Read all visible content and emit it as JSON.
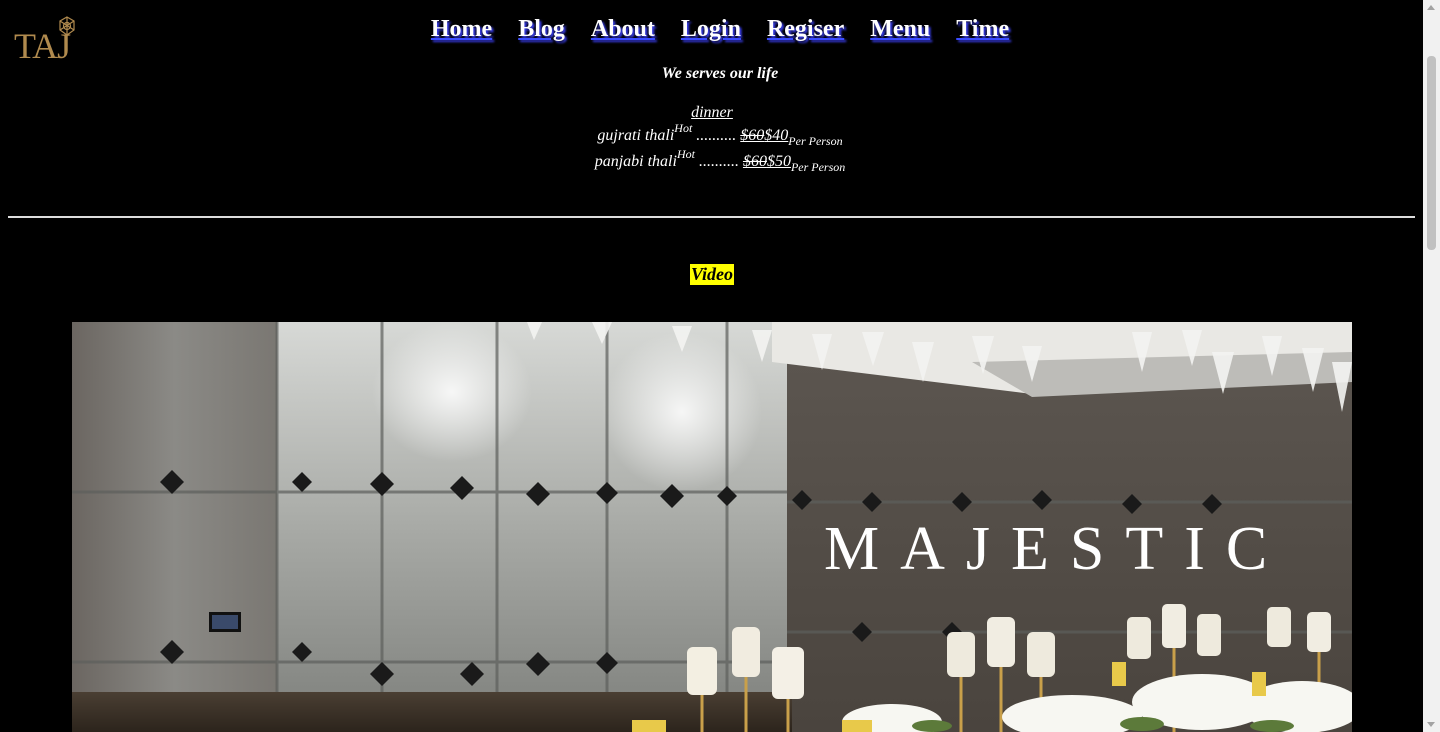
{
  "logo": {
    "text": "TAJ",
    "icon": "taj-emblem-icon",
    "color": "#b08a4e"
  },
  "nav": {
    "items": [
      {
        "label": "Home"
      },
      {
        "label": "Blog"
      },
      {
        "label": "About"
      },
      {
        "label": "Login"
      },
      {
        "label": "Regiser"
      },
      {
        "label": "Menu"
      },
      {
        "label": "Time"
      }
    ]
  },
  "tagline": "We serves our life",
  "menu": {
    "heading": "dinner",
    "items": [
      {
        "name": "gujrati thali",
        "badge": "Hot",
        "dots": " .......... ",
        "old_price": "$60",
        "new_price": "$40",
        "unit": "Per Person"
      },
      {
        "name": "panjabi thali",
        "badge": "Hot",
        "dots": " .......... ",
        "old_price": "$60",
        "new_price": "$50",
        "unit": "Per Person"
      }
    ]
  },
  "video": {
    "label": "Video",
    "label_bg": "#ffff00",
    "title": "MAJESTIC"
  }
}
